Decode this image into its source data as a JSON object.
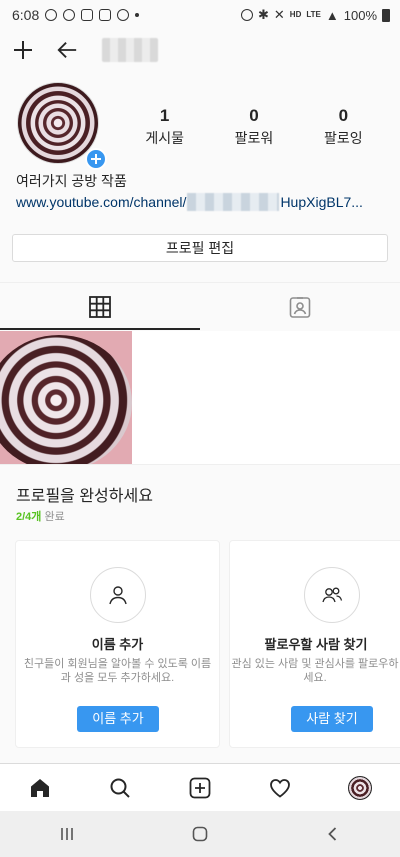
{
  "status_bar": {
    "time": "6:08",
    "network_hd": "HD",
    "network_lte": "LTE",
    "battery_percent": "100%"
  },
  "header": {
    "add_icon": "plus-icon",
    "back_icon": "arrow-left-icon"
  },
  "profile": {
    "stats": [
      {
        "value": "1",
        "label": "게시물"
      },
      {
        "value": "0",
        "label": "팔로워"
      },
      {
        "value": "0",
        "label": "팔로잉"
      }
    ],
    "display_name": "여러가지 공방 작품",
    "link_prefix": "www.youtube.com/channel/",
    "link_suffix": "HupXigBL7...",
    "edit_button": "프로필 편집"
  },
  "tabs": [
    {
      "icon": "grid-icon",
      "active": true
    },
    {
      "icon": "tagged-person-icon",
      "active": false
    }
  ],
  "complete_profile": {
    "title": "프로필을 완성하세요",
    "progress": "2/4개",
    "progress_suffix": " 완료",
    "cards": [
      {
        "icon": "person-icon",
        "title": "이름 추가",
        "description": "친구들이 회원님을 알아볼 수 있도록 이름과 성을 모두 추가하세요.",
        "button": "이름 추가"
      },
      {
        "icon": "people-icon",
        "title": "팔로우할 사람 찾기",
        "description": "관심 있는 사람 및 관심사를 팔로우하세요.",
        "button": "사람 찾기"
      }
    ]
  },
  "bottom_nav": [
    "home-icon",
    "search-icon",
    "new-post-icon",
    "heart-icon",
    "profile-avatar"
  ],
  "colors": {
    "accent": "#3897f0",
    "progress_green": "#58c322",
    "link": "#003569"
  }
}
